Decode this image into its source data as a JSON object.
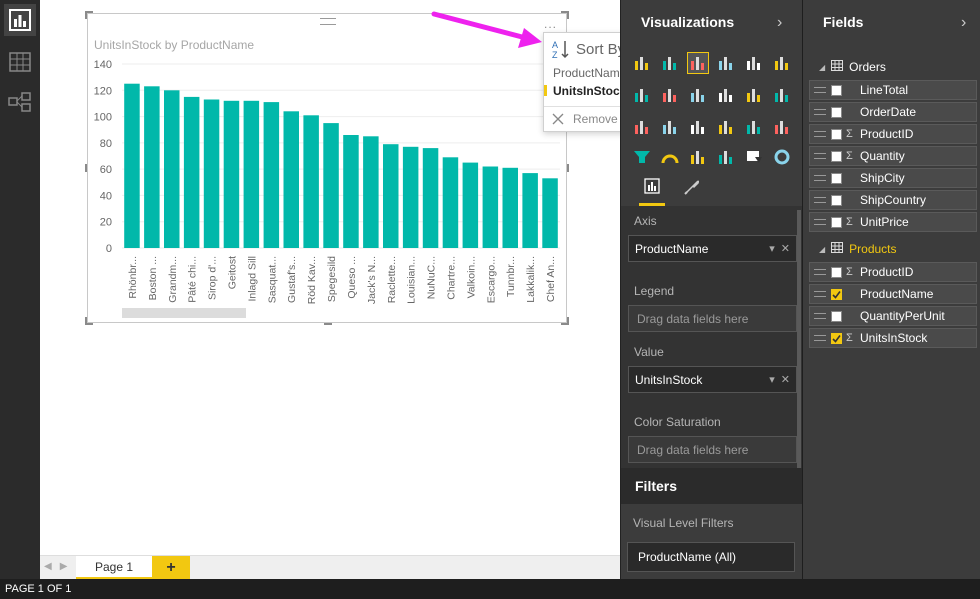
{
  "canvas": {
    "visual_title": "UnitsInStock by ProductName",
    "more_options": "...",
    "tabs": {
      "page_label": "Page 1",
      "add_label": "+"
    }
  },
  "sort_menu": {
    "title": "Sort By",
    "options": [
      "ProductName",
      "UnitsInStock"
    ],
    "selected": "UnitsInStock",
    "remove_label": "Remove"
  },
  "status": {
    "text": "PAGE 1 OF 1"
  },
  "chart_data": {
    "type": "bar",
    "title": "UnitsInStock by ProductName",
    "categories": [
      "Rhönbr...",
      "Boston ...",
      "Grandm...",
      "Pâté chi...",
      "Sirop d'...",
      "Geitost",
      "Inlagd Sill",
      "Sasquat...",
      "Gustaf's...",
      "Röd Kav...",
      "Spegesild",
      "Queso ...",
      "Jack's N...",
      "Raclette...",
      "Louisian...",
      "NuNuC...",
      "Chartre...",
      "Valkoin...",
      "Escargo...",
      "Tunnbr...",
      "Lakkalik...",
      "Chef An..."
    ],
    "values": [
      125,
      123,
      120,
      115,
      113,
      112,
      112,
      111,
      104,
      101,
      95,
      86,
      85,
      79,
      77,
      76,
      69,
      65,
      62,
      61,
      57,
      53
    ],
    "ylim": [
      0,
      140
    ],
    "yticks": [
      0,
      20,
      40,
      60,
      80,
      100,
      120,
      140
    ],
    "color": "#01b8aa",
    "grid": true,
    "xlabel": "",
    "ylabel": ""
  },
  "viz_pane": {
    "title": "Visualizations",
    "wells": {
      "axis_label": "Axis",
      "axis_value": "ProductName",
      "legend_label": "Legend",
      "legend_placeholder": "Drag data fields here",
      "value_label": "Value",
      "value_value": "UnitsInStock",
      "saturation_label": "Color Saturation",
      "saturation_placeholder": "Drag data fields here"
    },
    "filters": {
      "title": "Filters",
      "visual_level_label": "Visual Level Filters",
      "item": "ProductName (All)"
    }
  },
  "fields_pane": {
    "title": "Fields",
    "tables": [
      {
        "name": "Orders",
        "fields": [
          {
            "name": "LineTotal",
            "sigma": false,
            "checked": false
          },
          {
            "name": "OrderDate",
            "sigma": false,
            "checked": false
          },
          {
            "name": "ProductID",
            "sigma": true,
            "checked": false
          },
          {
            "name": "Quantity",
            "sigma": true,
            "checked": false
          },
          {
            "name": "ShipCity",
            "sigma": false,
            "checked": false
          },
          {
            "name": "ShipCountry",
            "sigma": false,
            "checked": false
          },
          {
            "name": "UnitPrice",
            "sigma": true,
            "checked": false
          }
        ]
      },
      {
        "name": "Products",
        "fields": [
          {
            "name": "ProductID",
            "sigma": true,
            "checked": false
          },
          {
            "name": "ProductName",
            "sigma": false,
            "checked": true
          },
          {
            "name": "QuantityPerUnit",
            "sigma": false,
            "checked": false
          },
          {
            "name": "UnitsInStock",
            "sigma": true,
            "checked": true
          }
        ]
      }
    ]
  },
  "colors": {
    "accent": "#f2c811",
    "bar": "#01b8aa",
    "arrow": "#ee22ee"
  }
}
